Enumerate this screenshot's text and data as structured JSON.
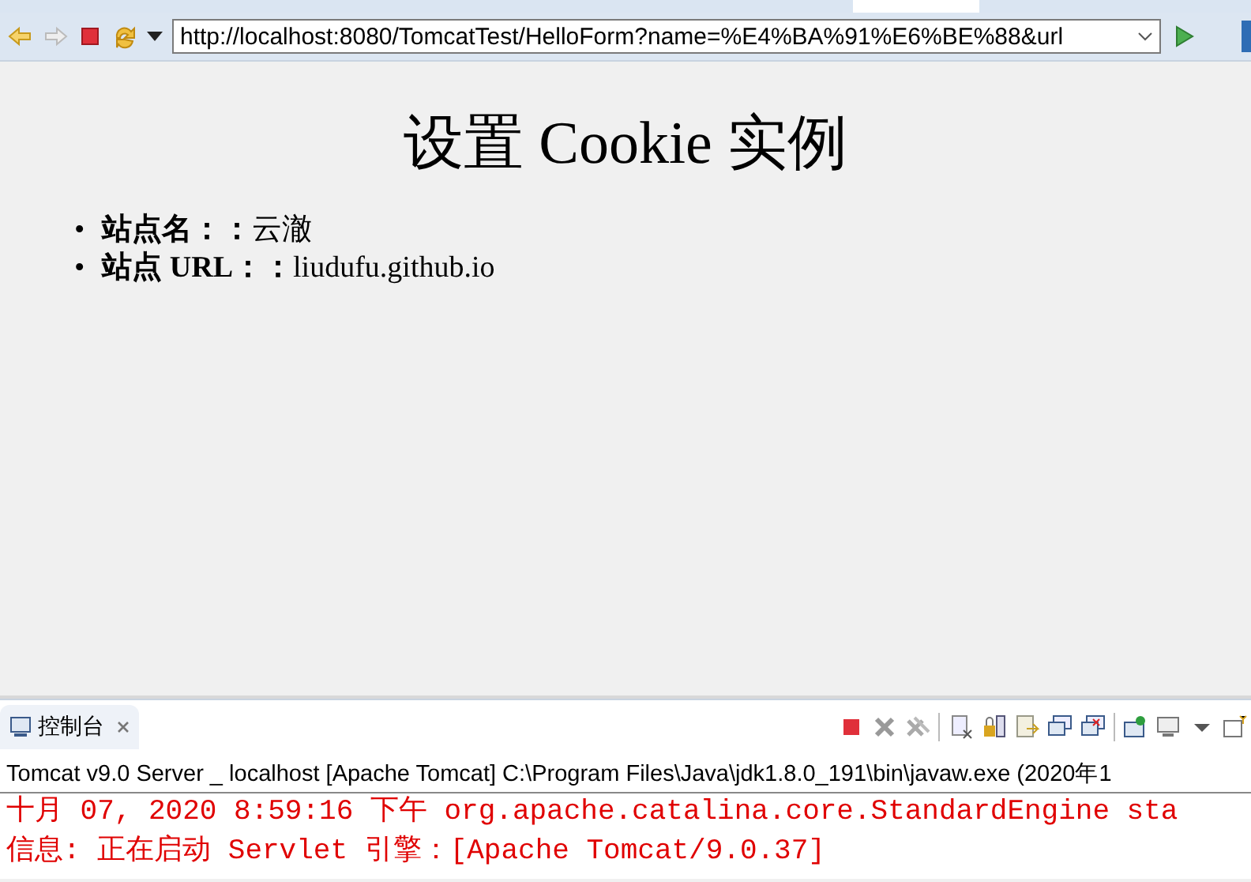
{
  "browser": {
    "address": "http://localhost:8080/TomcatTest/HelloForm?name=%E4%BA%91%E6%BE%88&url"
  },
  "page": {
    "heading": "设置 Cookie 实例",
    "items": [
      {
        "bullet": "•",
        "text": "**站点名：：**云澈"
      },
      {
        "bullet": "•",
        "text": "**站点 URL：：**liudufu.github.io"
      }
    ]
  },
  "console": {
    "tab": {
      "label": "控制台",
      "selected": true
    },
    "header": "Tomcat v9.0 Server _ localhost [Apache Tomcat] C:\\Program Files\\Java\\jdk1.8.0_191\\bin\\javaw.exe  (2020年1",
    "lines": [
      "十月 07, 2020 8:59:16 下午 org.apache.catalina.core.StandardEngine sta",
      "信息: 正在启动 Servlet 引擎：[Apache Tomcat/9.0.37]"
    ]
  }
}
